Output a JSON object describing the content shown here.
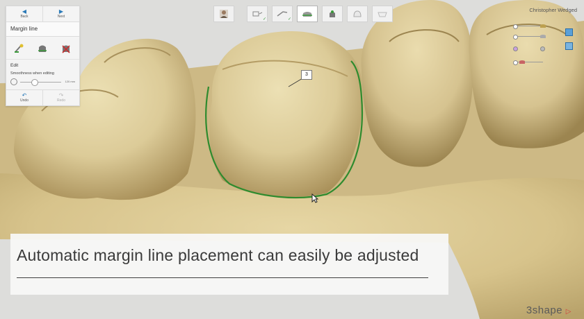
{
  "nav": {
    "back_label": "Back",
    "next_label": "Next"
  },
  "panel": {
    "title": "Margin line",
    "tools": [
      "auto-margin-icon",
      "preparation-icon",
      "delete-margin-icon"
    ],
    "edit_label": "Edit",
    "smoothness_label": "Smoothness when editing",
    "smoothness_value": "120 mm",
    "undo_label": "Undo",
    "redo_label": "Redo"
  },
  "toolbar": {
    "items": [
      "user-icon",
      "scan-icon",
      "margin-tool-icon",
      "model-icon",
      "die-icon",
      "crown-icon",
      "bridge-icon"
    ]
  },
  "user": {
    "name": "Christopher Wedged"
  },
  "marker": {
    "label": "3"
  },
  "caption": {
    "text": "Automatic margin line placement can easily be adjusted"
  },
  "brand": {
    "name": "3shape"
  },
  "colors": {
    "accent": "#2a7ab8",
    "margin_line": "#2e8b2e",
    "tooth": "#dccb98",
    "gum": "#d7c38b"
  }
}
